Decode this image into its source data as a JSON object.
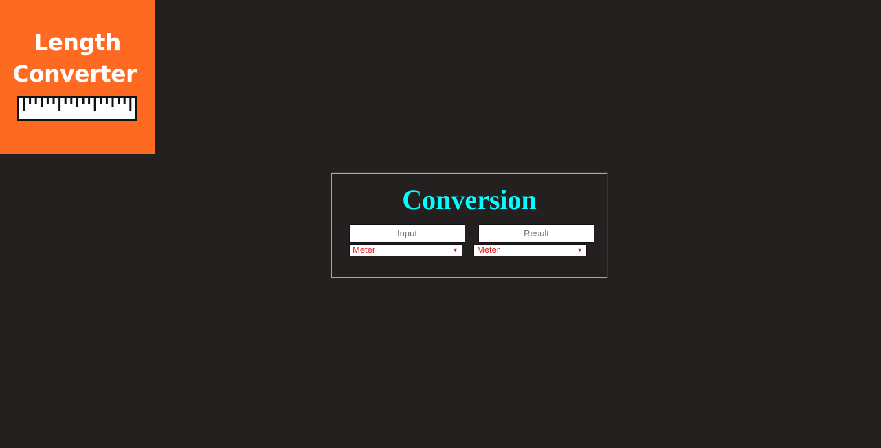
{
  "logo": {
    "line1": "Length",
    "line2": "Converter",
    "ruler_icon": "ruler-icon",
    "background": "#ff6a22"
  },
  "panel": {
    "title": "Conversion",
    "input": {
      "placeholder": "Input",
      "value": ""
    },
    "equals": "=",
    "result": {
      "placeholder": "Result",
      "value": ""
    },
    "from_unit": {
      "selected": "Meter"
    },
    "to_unit": {
      "selected": "Meter"
    }
  },
  "colors": {
    "page_background": "#252020",
    "title": "#00ffff",
    "unit_text": "#e02020"
  }
}
